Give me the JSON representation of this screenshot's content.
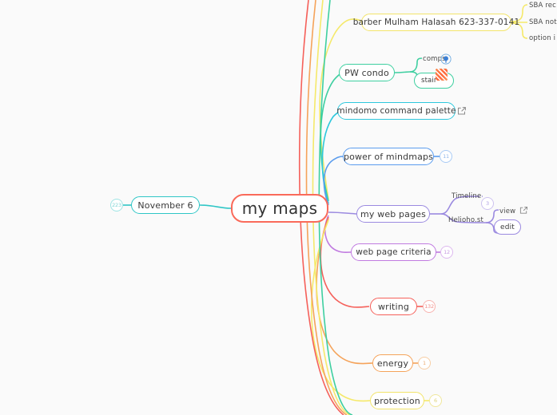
{
  "app": {
    "name": "mindomo-mindmap",
    "background_color": "#fafafa"
  },
  "mindmap": {
    "root": {
      "label": "my maps",
      "color": "#fa6a5a"
    },
    "left_branches": [
      {
        "label": "November 6",
        "color": "#2fc6c6",
        "badge": "223"
      }
    ],
    "right_branches": [
      {
        "label": "barber Mulham Halasah 623-337-0141",
        "color": "#f5e96a",
        "children": [
          {
            "label": "SBA rec",
            "color": "#f5e96a"
          },
          {
            "label": "SBA not",
            "color": "#f5e96a"
          },
          {
            "label": "option i",
            "color": "#f5e96a"
          }
        ]
      },
      {
        "label": "PW condo",
        "color": "#3ecfa0",
        "children": [
          {
            "label": "comps",
            "color": "#3ecfa0",
            "icon": "map-pin-icon"
          },
          {
            "label": "stair",
            "color": "#3ecfa0",
            "icon": "image-thumbnail-icon"
          }
        ]
      },
      {
        "label": "mindomo command palette",
        "color": "#2ec8dd",
        "icon": "external-link-icon"
      },
      {
        "label": "power of mindmaps",
        "color": "#5b9ced",
        "badge": "11"
      },
      {
        "label": "my web pages",
        "color": "#9b8ae0",
        "children": [
          {
            "label": "Timeline",
            "color": "#9b8ae0",
            "badge": "3"
          },
          {
            "label": "Helioho.st",
            "color": "#9b8ae0",
            "children": [
              {
                "label": "view",
                "color": "#9b8ae0",
                "icon": "external-link-icon"
              },
              {
                "label": "edit",
                "color": "#9b8ae0"
              }
            ]
          }
        ]
      },
      {
        "label": "web page criteria",
        "color": "#c07ae0",
        "badge": "12"
      },
      {
        "label": "writing",
        "color": "#f5605a",
        "badge": "132"
      },
      {
        "label": "energy",
        "color": "#f5a35a",
        "badge": "1"
      },
      {
        "label": "protection",
        "color": "#f5e96a",
        "badge": "6"
      }
    ]
  }
}
